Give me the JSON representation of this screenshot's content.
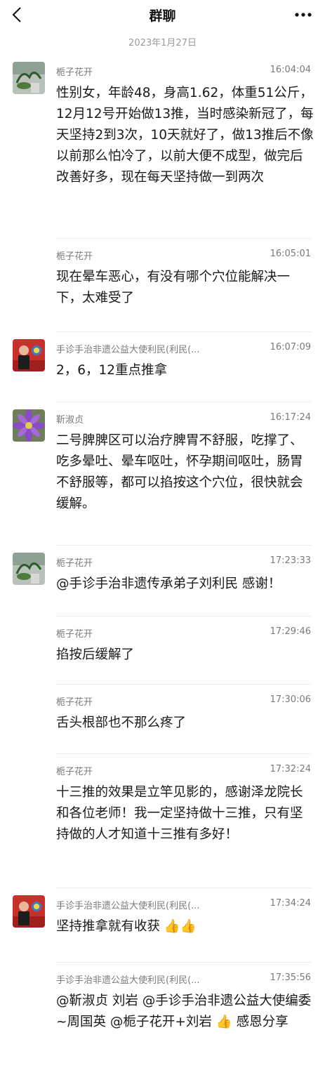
{
  "header": {
    "title": "群聊",
    "back_icon": "chevron-left-icon",
    "more_icon": "more-dots-icon"
  },
  "date_separator": "2023年1月27日",
  "messages": [
    {
      "sender": "栀子花开",
      "time": "16:04:04",
      "avatar": "avatar-plant",
      "text": "性别女，年龄48，身高1.62，体重51公斤，12月12号开始做13推，当时感染新冠了，每天坚持2到3次，10天就好了，做13推后不像以前那么怕冷了，以前大便不成型，做完后改善好多，现在每天坚持做一到两次"
    },
    {
      "sender": "栀子花开",
      "time": "16:05:01",
      "avatar": "",
      "text": "现在晕车恶心，有没有哪个穴位能解决一下，太难受了"
    },
    {
      "sender": "手诊手治非遗公益大使利民(利民(...",
      "time": "16:07:09",
      "avatar": "avatar-person",
      "text": "2，6，12重点推拿"
    },
    {
      "sender": "靳淑贞",
      "time": "16:17:24",
      "avatar": "avatar-flower",
      "text": "二号脾脾区可以治疗脾胃不舒服，吃撑了、吃多晕吐、晕车呕吐，怀孕期间呕吐，肠胃不舒服等，都可以掐按这个穴位，很快就会缓解。"
    },
    {
      "sender": "栀子花开",
      "time": "17:23:33",
      "avatar": "avatar-plant",
      "text": "@手诊手治非遗传承弟子刘利民 感谢！"
    },
    {
      "sender": "栀子花开",
      "time": "17:29:46",
      "avatar": "",
      "text": "掐按后缓解了"
    },
    {
      "sender": "栀子花开",
      "time": "17:30:06",
      "avatar": "",
      "text": "舌头根部也不那么疼了"
    },
    {
      "sender": "栀子花开",
      "time": "17:32:24",
      "avatar": "",
      "text": "十三推的效果是立竿见影的，感谢泽龙院长和各位老师！我一定坚持做十三推，只有坚持做的人才知道十三推有多好！"
    },
    {
      "sender": "手诊手治非遗公益大使利民(利民(...",
      "time": "17:34:24",
      "avatar": "avatar-person",
      "text": "坚持推拿就有收获 👍👍"
    },
    {
      "sender": "手诊手治非遗公益大使利民(利民(...",
      "time": "17:35:56",
      "avatar": "",
      "text": "@靳淑贞    刘岩 @手诊手治非遗公益大使编委~周国英 @栀子花开+刘岩 👍 感恩分享"
    }
  ]
}
